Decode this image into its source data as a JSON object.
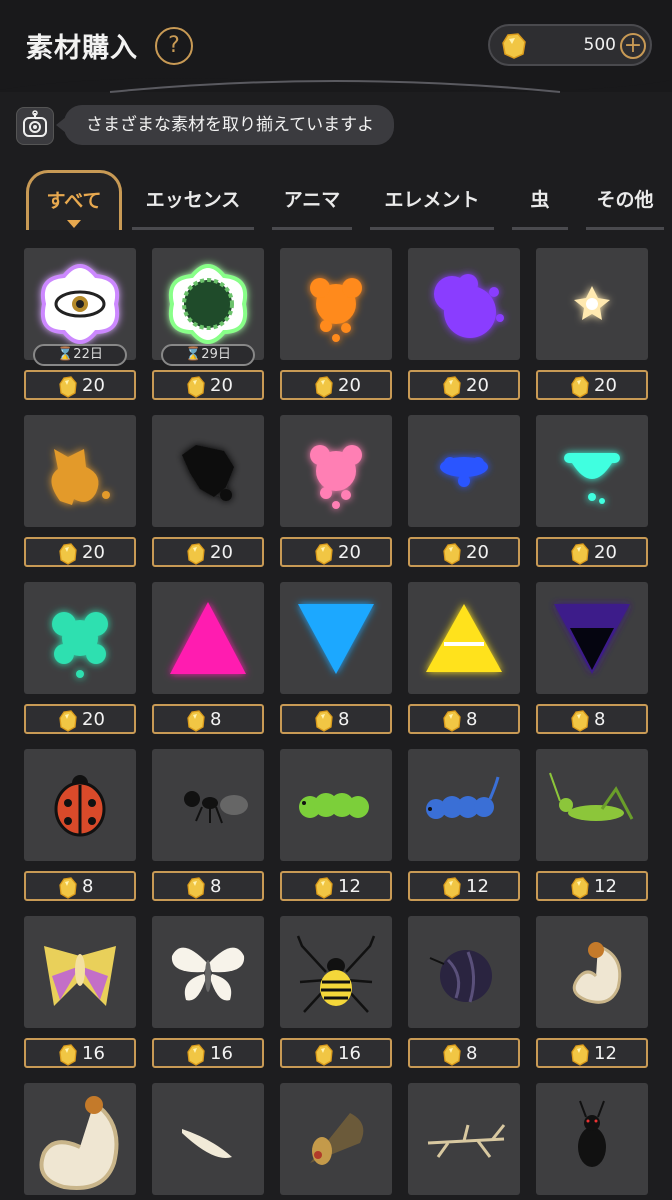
{
  "header": {
    "title": "素材購入",
    "help_label": "?",
    "coins": "500",
    "plus_label": "+"
  },
  "assistant": {
    "message": "さまざまな素材を取り揃えていますよ"
  },
  "tabs": [
    {
      "label": "すべて",
      "active": true
    },
    {
      "label": "エッセンス"
    },
    {
      "label": "アニマ"
    },
    {
      "label": "エレメント"
    },
    {
      "label": "虫"
    },
    {
      "label": "その他"
    }
  ],
  "items": [
    {
      "icon": "eye-flower-icon",
      "price": "20",
      "days": "⌛22日"
    },
    {
      "icon": "flower-garden-icon",
      "price": "20",
      "days": "⌛29日"
    },
    {
      "icon": "orange-anima-icon",
      "price": "20"
    },
    {
      "icon": "purple-anima-icon",
      "price": "20"
    },
    {
      "icon": "white-sparkle-anima-icon",
      "price": "20"
    },
    {
      "icon": "amber-fox-anima-icon",
      "price": "20"
    },
    {
      "icon": "black-anima-icon",
      "price": "20"
    },
    {
      "icon": "pink-anima-icon",
      "price": "20"
    },
    {
      "icon": "blue-anima-icon",
      "price": "20"
    },
    {
      "icon": "cyan-anima-icon",
      "price": "20"
    },
    {
      "icon": "teal-anima-icon",
      "price": "20"
    },
    {
      "icon": "magenta-triangle-icon",
      "price": "8"
    },
    {
      "icon": "blue-triangle-icon",
      "price": "8"
    },
    {
      "icon": "yellow-triangle-icon",
      "price": "8"
    },
    {
      "icon": "dark-triangle-icon",
      "price": "8"
    },
    {
      "icon": "ladybug-icon",
      "price": "8"
    },
    {
      "icon": "ant-icon",
      "price": "8"
    },
    {
      "icon": "green-caterpillar-icon",
      "price": "12"
    },
    {
      "icon": "blue-caterpillar-icon",
      "price": "12"
    },
    {
      "icon": "grasshopper-icon",
      "price": "12"
    },
    {
      "icon": "moth-icon",
      "price": "16"
    },
    {
      "icon": "butterfly-icon",
      "price": "16"
    },
    {
      "icon": "spider-icon",
      "price": "16"
    },
    {
      "icon": "pillbug-icon",
      "price": "8"
    },
    {
      "icon": "grub-icon",
      "price": "12"
    },
    {
      "icon": "large-grub-icon",
      "price": ""
    },
    {
      "icon": "seed-icon",
      "price": ""
    },
    {
      "icon": "cicada-icon",
      "price": ""
    },
    {
      "icon": "stick-insect-icon",
      "price": ""
    },
    {
      "icon": "black-beetle-icon",
      "price": ""
    }
  ],
  "colors": {
    "accent": "#c89a55",
    "accent_text": "#e8a94f",
    "background": "#1d1d1f",
    "tile": "#3e3e40"
  }
}
